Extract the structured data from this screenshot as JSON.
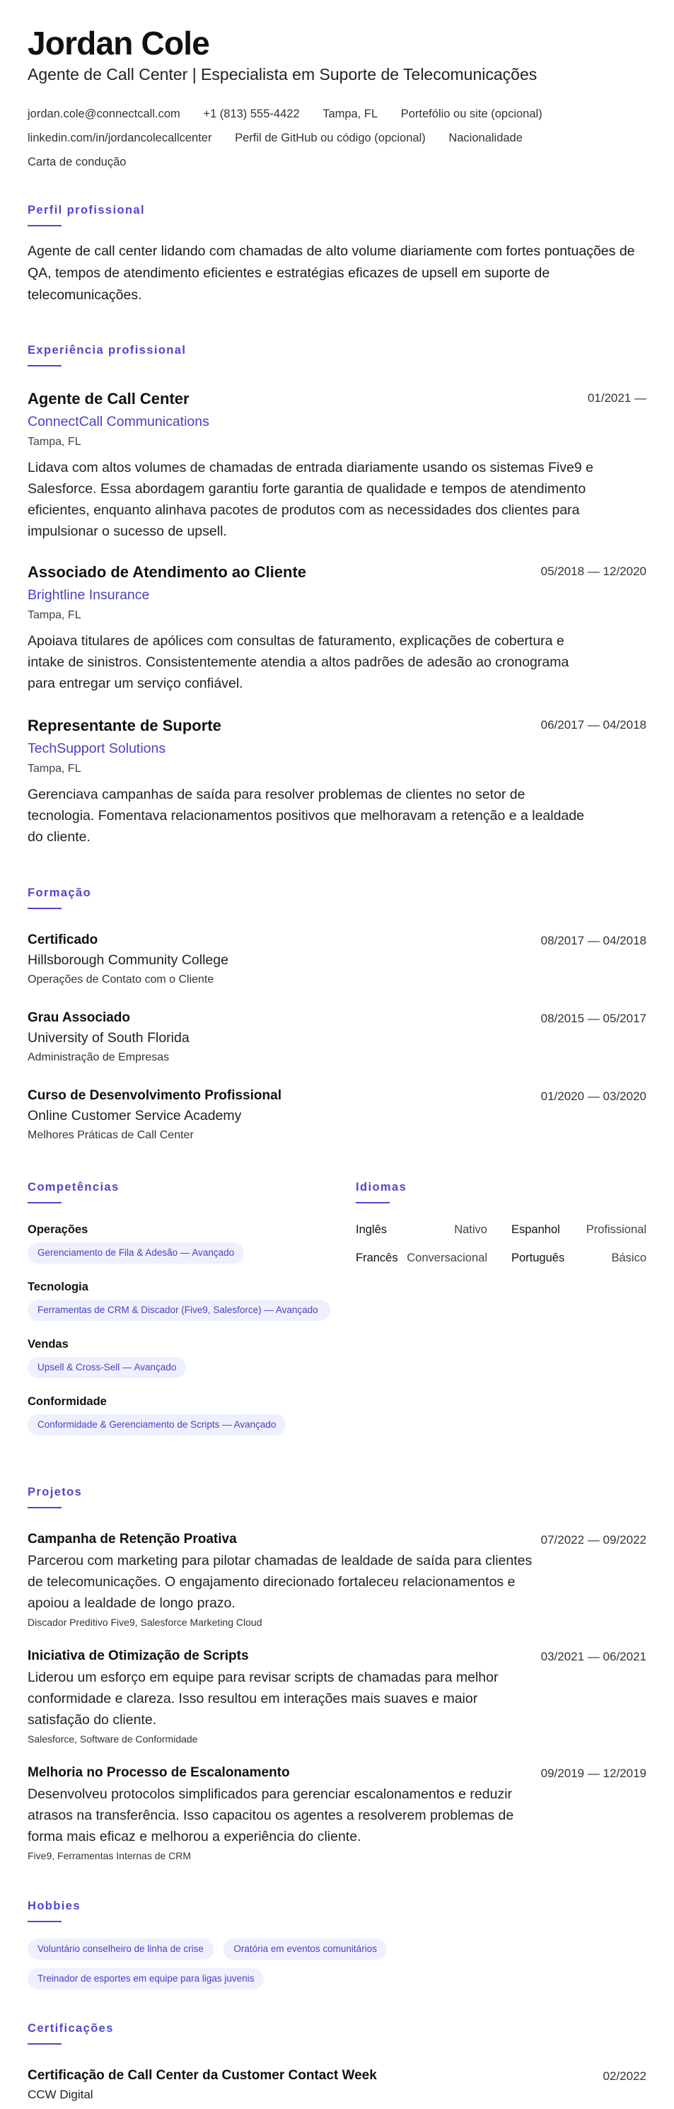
{
  "header": {
    "name": "Jordan Cole",
    "headline": "Agente de Call Center | Especialista em Suporte de Telecomunicações",
    "contacts": [
      "jordan.cole@connectcall.com",
      "+1 (813) 555-4422",
      "Tampa, FL",
      "Portefólio ou site (opcional)",
      "linkedin.com/in/jordancolecallcenter",
      "Perfil de GitHub ou código (opcional)",
      "Nacionalidade",
      "Carta de condução"
    ]
  },
  "sections": {
    "profile": "Perfil profissional",
    "experience": "Experiência profissional",
    "education": "Formação",
    "skills": "Competências",
    "languages": "Idiomas",
    "projects": "Projetos",
    "hobbies": "Hobbies",
    "certifications": "Certificações"
  },
  "summary": "Agente de call center lidando com chamadas de alto volume diariamente com fortes pontuações de QA, tempos de atendimento eficientes e estratégias eficazes de upsell em suporte de telecomunicações.",
  "experience": [
    {
      "title": "Agente de Call Center",
      "company": "ConnectCall Communications",
      "location": "Tampa, FL",
      "dates": "01/2021 —",
      "description": "Lidava com altos volumes de chamadas de entrada diariamente usando os sistemas Five9 e Salesforce. Essa abordagem garantiu forte garantia de qualidade e tempos de atendimento eficientes, enquanto alinhava pacotes de produtos com as necessidades dos clientes para impulsionar o sucesso de upsell."
    },
    {
      "title": "Associado de Atendimento ao Cliente",
      "company": "Brightline Insurance",
      "location": "Tampa, FL",
      "dates": "05/2018 — 12/2020",
      "description": "Apoiava titulares de apólices com consultas de faturamento, explicações de cobertura e intake de sinistros. Consistentemente atendia a altos padrões de adesão ao cronograma para entregar um serviço confiável."
    },
    {
      "title": "Representante de Suporte",
      "company": "TechSupport Solutions",
      "location": "Tampa, FL",
      "dates": "06/2017 — 04/2018",
      "description": "Gerenciava campanhas de saída para resolver problemas de clientes no setor de tecnologia. Fomentava relacionamentos positivos que melhoravam a retenção e a lealdade do cliente."
    }
  ],
  "education": [
    {
      "degree": "Certificado",
      "institution": "Hillsborough Community College",
      "field": "Operações de Contato com o Cliente",
      "dates": "08/2017 — 04/2018"
    },
    {
      "degree": "Grau Associado",
      "institution": "University of South Florida",
      "field": "Administração de Empresas",
      "dates": "08/2015 — 05/2017"
    },
    {
      "degree": "Curso de Desenvolvimento Profissional",
      "institution": "Online Customer Service Academy",
      "field": "Melhores Práticas de Call Center",
      "dates": "01/2020 — 03/2020"
    }
  ],
  "skills": [
    {
      "category": "Operações",
      "item": "Gerenciamento de Fila & Adesão — Avançado"
    },
    {
      "category": "Tecnologia",
      "item": "Ferramentas de CRM & Discador (Five9, Salesforce) — Avançado"
    },
    {
      "category": "Vendas",
      "item": "Upsell & Cross-Sell — Avançado"
    },
    {
      "category": "Conformidade",
      "item": "Conformidade & Gerenciamento de Scripts — Avançado"
    }
  ],
  "languages": [
    {
      "name": "Inglês",
      "level": "Nativo"
    },
    {
      "name": "Espanhol",
      "level": "Profissional"
    },
    {
      "name": "Francês",
      "level": "Conversacional"
    },
    {
      "name": "Português",
      "level": "Básico"
    }
  ],
  "projects": [
    {
      "title": "Campanha de Retenção Proativa",
      "dates": "07/2022 — 09/2022",
      "description": "Parcerou com marketing para pilotar chamadas de lealdade de saída para clientes de telecomunicações. O engajamento direcionado fortaleceu relacionamentos e apoiou a lealdade de longo prazo.",
      "tech": "Discador Preditivo Five9, Salesforce Marketing Cloud"
    },
    {
      "title": "Iniciativa de Otimização de Scripts",
      "dates": "03/2021 — 06/2021",
      "description": "Liderou um esforço em equipe para revisar scripts de chamadas para melhor conformidade e clareza. Isso resultou em interações mais suaves e maior satisfação do cliente.",
      "tech": "Salesforce, Software de Conformidade"
    },
    {
      "title": "Melhoria no Processo de Escalonamento",
      "dates": "09/2019 — 12/2019",
      "description": "Desenvolveu protocolos simplificados para gerenciar escalonamentos e reduzir atrasos na transferência. Isso capacitou os agentes a resolverem problemas de forma mais eficaz e melhorou a experiência do cliente.",
      "tech": "Five9, Ferramentas Internas de CRM"
    }
  ],
  "hobbies": [
    "Voluntário conselheiro de linha de crise",
    "Oratória em eventos comunitários",
    "Treinador de esportes em equipe para ligas juvenis"
  ],
  "certifications": [
    {
      "name": "Certificação de Call Center da Customer Contact Week",
      "issuer": "CCW Digital",
      "date": "02/2022"
    }
  ]
}
